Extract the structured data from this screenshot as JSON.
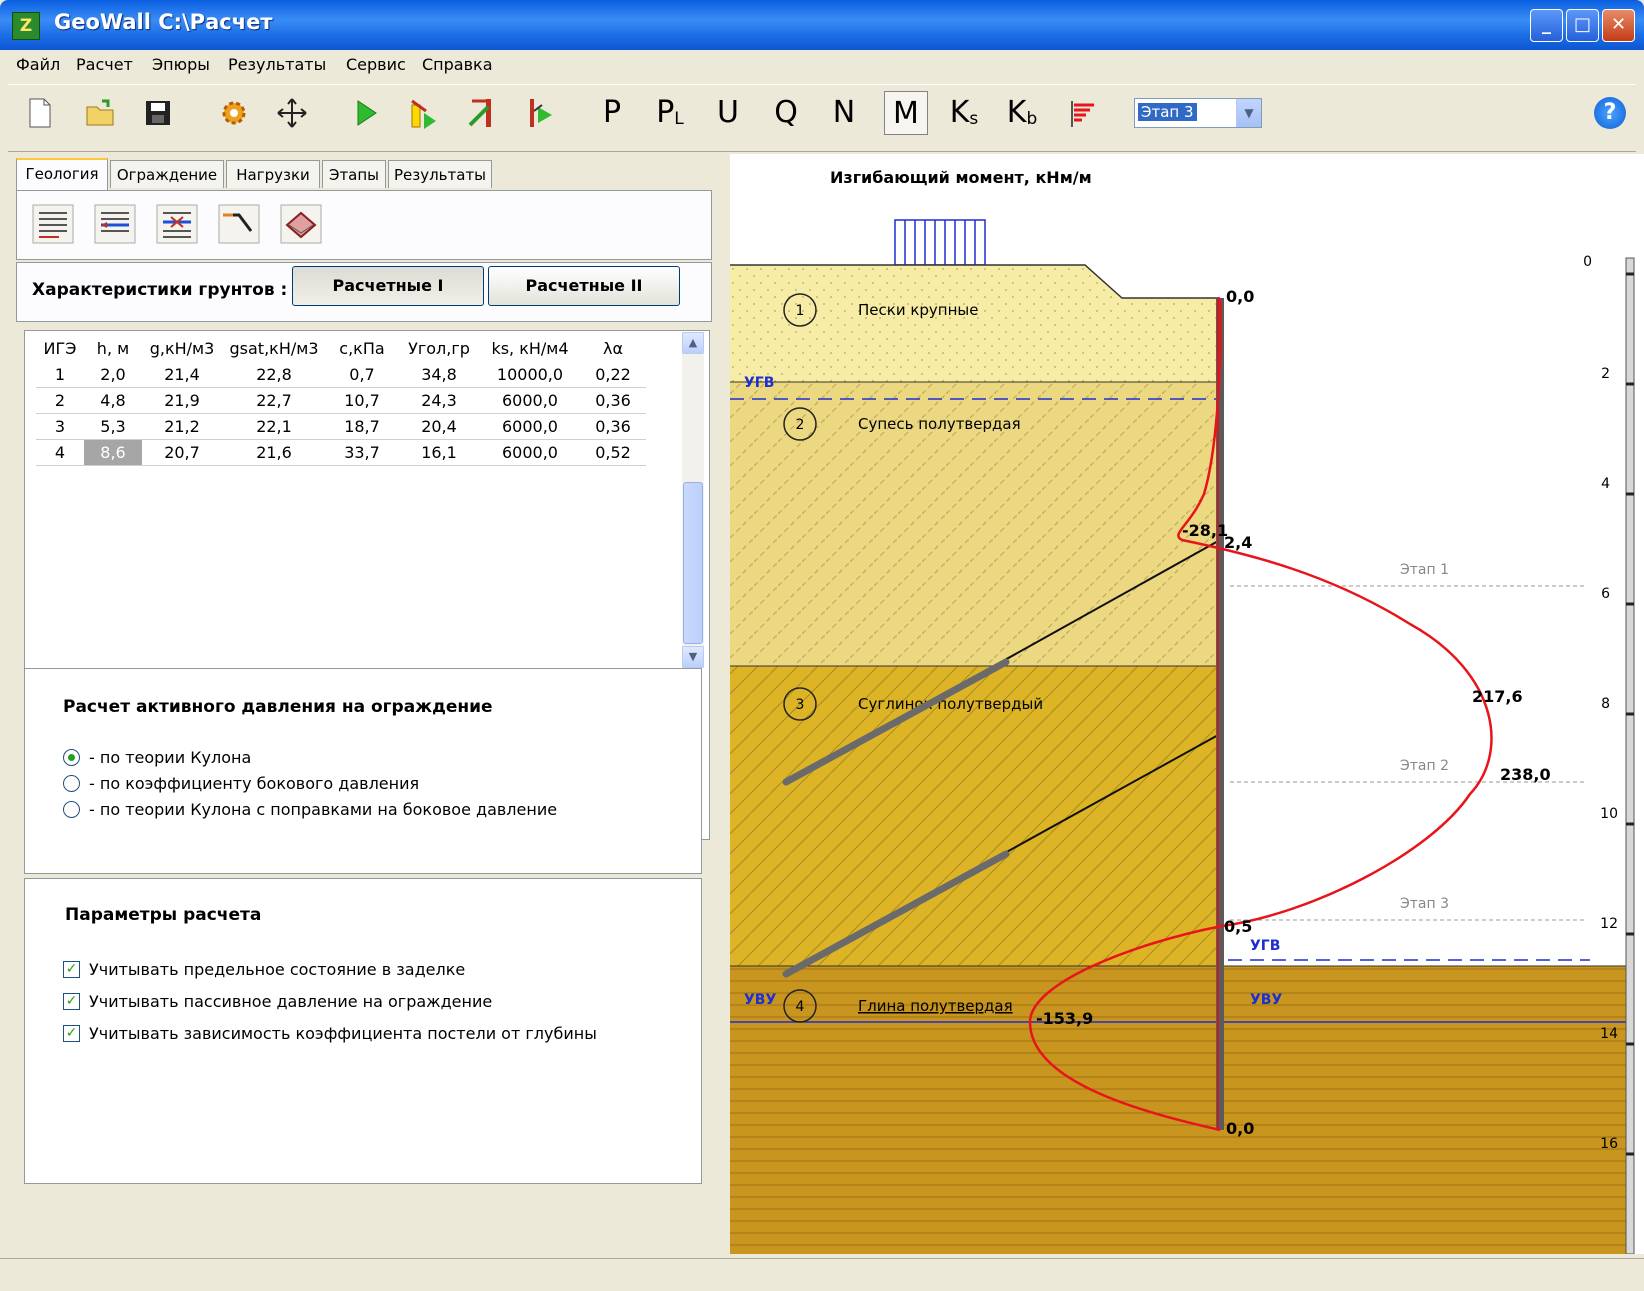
{
  "window": {
    "title": "GeoWall C:\\Расчет",
    "minimize": "_",
    "maximize": "□",
    "close": "✕"
  },
  "menu": [
    "Файл",
    "Расчет",
    "Эпюры",
    "Результаты",
    "Сервис",
    "Справка"
  ],
  "toolbar": {
    "icons": [
      "new-file-icon",
      "open-folder-icon",
      "save-icon",
      "settings-gear-icon",
      "move-icon",
      "run-icon",
      "load-icon",
      "stage-anchor-icon",
      "stage-wall-icon",
      "diagram-icon"
    ],
    "diagram_buttons": [
      {
        "main": "P",
        "sub": ""
      },
      {
        "main": "P",
        "sub": "L"
      },
      {
        "main": "U",
        "sub": ""
      },
      {
        "main": "Q",
        "sub": ""
      },
      {
        "main": "N",
        "sub": ""
      },
      {
        "main": "M",
        "sub": ""
      },
      {
        "main": "K",
        "sub": "s"
      },
      {
        "main": "K",
        "sub": "b"
      }
    ],
    "active_diagram": "M",
    "stage_select": "Этап 3",
    "help": "?"
  },
  "tabs": [
    "Геология",
    "Ограждение",
    "Нагрузки",
    "Этапы",
    "Результаты"
  ],
  "active_tab": "Геология",
  "soil": {
    "label": "Характеристики грунтов :",
    "button_1": "Расчетные I",
    "button_2": "Расчетные II",
    "columns": [
      "ИГЭ",
      "h, м",
      "g,кН/м3",
      "gsat,кН/м3",
      "c,кПа",
      "Угол,гр",
      "ks, кН/м4",
      "λα"
    ],
    "rows": [
      [
        "1",
        "2,0",
        "21,4",
        "22,8",
        "0,7",
        "34,8",
        "10000,0",
        "0,22"
      ],
      [
        "2",
        "4,8",
        "21,9",
        "22,7",
        "10,7",
        "24,3",
        "6000,0",
        "0,36"
      ],
      [
        "3",
        "5,3",
        "21,2",
        "22,1",
        "18,7",
        "20,4",
        "6000,0",
        "0,36"
      ],
      [
        "4",
        "8,6",
        "20,7",
        "21,6",
        "33,7",
        "16,1",
        "6000,0",
        "0,52"
      ]
    ]
  },
  "active_pressure": {
    "title": "Расчет активного давления на ограждение",
    "options": [
      "- по теории Кулона",
      "- по коэффициенту бокового давления",
      "- по теории Кулона с поправками на боковое давление"
    ],
    "selected": 0
  },
  "params": {
    "title": "Параметры расчета",
    "checks": [
      "Учитывать предельное состояние в заделке",
      "Учитывать пассивное давление на ограждение",
      "Учитывать зависимость коэффициента постели от глубины"
    ]
  },
  "drawing": {
    "title": "Изгибающий момент, кНм/м",
    "layers": [
      {
        "num": "1",
        "name": "Пески крупные",
        "color": "#f6eca6"
      },
      {
        "num": "2",
        "name": "Супесь полутвердая",
        "color": "#ecd880"
      },
      {
        "num": "3",
        "name": "Суглинок полутвердый",
        "color": "#dcb426"
      },
      {
        "num": "4",
        "name": "Глина полутвердая",
        "color": "#c8961e"
      }
    ],
    "water_labels": {
      "ugv": "УГВ",
      "uvu": "УВУ"
    },
    "stages": [
      "Этап 1",
      "Этап 2",
      "Этап 3"
    ],
    "moment_labels": [
      "0,0",
      "-28,1",
      "2,4",
      "217,6",
      "238,0",
      "0,5",
      "-153,9",
      "0,0"
    ],
    "depth_ticks": [
      "0",
      "2",
      "4",
      "6",
      "8",
      "10",
      "12",
      "14",
      "16"
    ],
    "curve_color": "#e8141b"
  }
}
